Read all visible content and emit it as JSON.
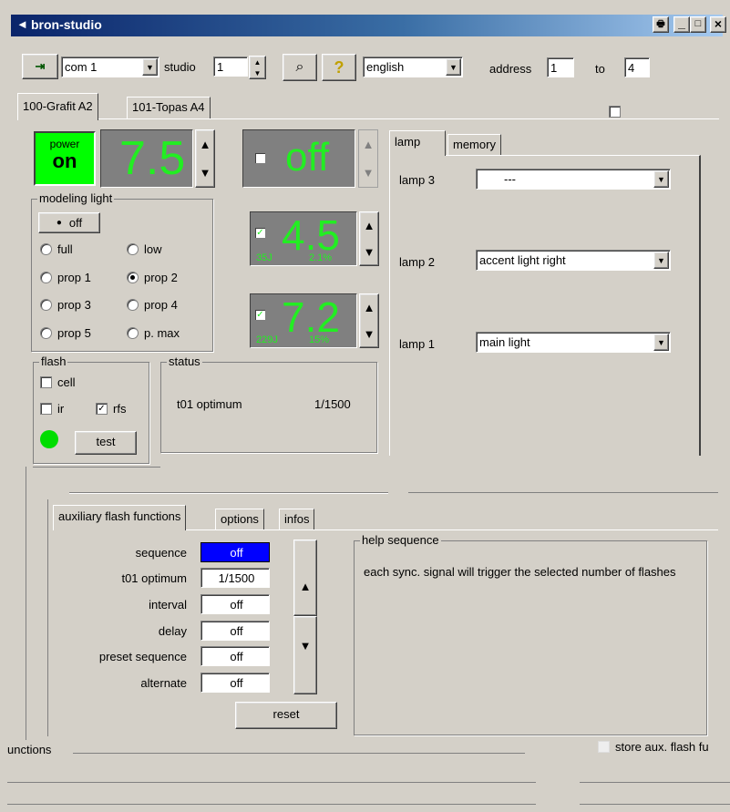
{
  "window": {
    "title": "bron-studio",
    "title_bar_color": "#0a246a"
  },
  "toolbar": {
    "port": "com 1",
    "studio_label": "studio",
    "studio_value": "1",
    "language": "english",
    "address_label": "address",
    "address_from": "1",
    "to_label": "to",
    "address_to": "4"
  },
  "device_tabs": [
    "100-Grafit A2",
    "101-Topas A4"
  ],
  "power": {
    "label": "power",
    "state": "on",
    "value": "7.5"
  },
  "modeling": {
    "title": "modeling light",
    "off_button": "off",
    "options": [
      "full",
      "low",
      "prop 1",
      "prop 2",
      "prop 3",
      "prop 4",
      "prop 5",
      "p. max"
    ],
    "selected": "prop 2"
  },
  "flash": {
    "title": "flash",
    "cell": "cell",
    "ir": "ir",
    "rfs": "rfs",
    "test_button": "test",
    "indicator_color": "#00dd00"
  },
  "status": {
    "title": "status",
    "text": "t01 optimum",
    "value": "1/1500"
  },
  "channels": [
    {
      "value": "off",
      "checked": false
    },
    {
      "value": "4.5",
      "joule": "35J",
      "percent": "2.1%",
      "checked": true
    },
    {
      "value": "7.2",
      "joule": "229J",
      "percent": "15%",
      "checked": true
    }
  ],
  "lamp_tabs": [
    "lamp",
    "memory"
  ],
  "lamps": [
    {
      "label": "lamp 3",
      "value": "---"
    },
    {
      "label": "lamp 2",
      "value": "accent light right"
    },
    {
      "label": "lamp 1",
      "value": "main light"
    }
  ],
  "aux_tabs": [
    "auxiliary flash functions",
    "options",
    "infos"
  ],
  "aux": {
    "rows": [
      {
        "label": "sequence",
        "value": "off"
      },
      {
        "label": "t01 optimum",
        "value": "1/1500"
      },
      {
        "label": "interval",
        "value": "off"
      },
      {
        "label": "delay",
        "value": "off"
      },
      {
        "label": "preset sequence",
        "value": "off"
      },
      {
        "label": "alternate",
        "value": "off"
      }
    ],
    "reset_button": "reset",
    "selected_color": "#0000ff"
  },
  "help": {
    "title": "help sequence",
    "text": "each sync. signal will trigger the selected number of flashes"
  },
  "bottom": {
    "functions_label": "unctions",
    "store_label": "store aux. flash fu"
  },
  "colors": {
    "digit": "#22ee22",
    "display_bg": "#808080",
    "power_on": "#00ff00"
  }
}
